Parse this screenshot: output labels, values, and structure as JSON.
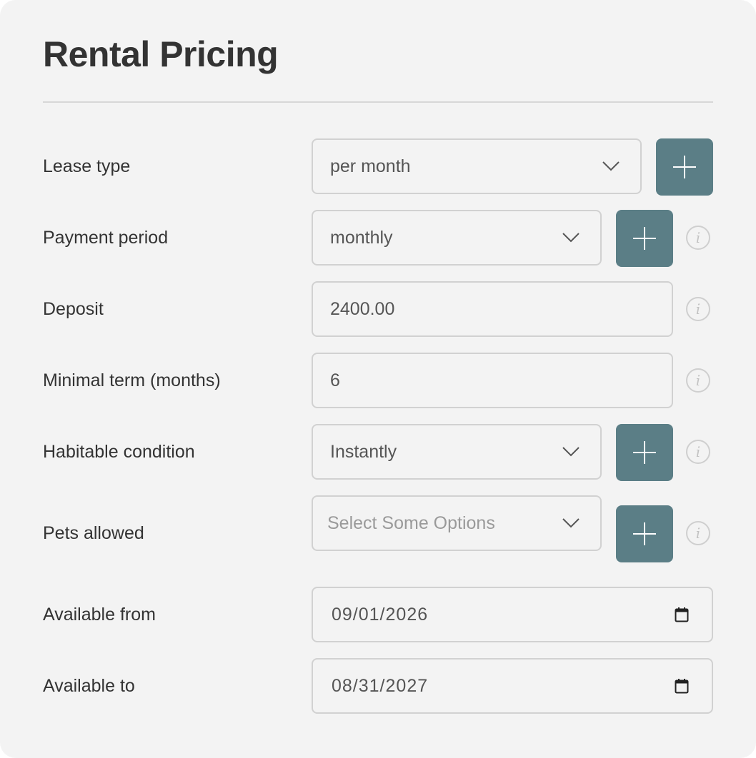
{
  "title": "Rental Pricing",
  "fields": {
    "lease_type": {
      "label": "Lease type",
      "value": "per month"
    },
    "payment_period": {
      "label": "Payment period",
      "value": "monthly"
    },
    "deposit": {
      "label": "Deposit",
      "value": "2400.00"
    },
    "minimal_term": {
      "label": "Minimal term (months)",
      "value": "6"
    },
    "habitable_condition": {
      "label": "Habitable condition",
      "value": "Instantly"
    },
    "pets_allowed": {
      "label": "Pets allowed",
      "placeholder": "Select Some Options"
    },
    "available_from": {
      "label": "Available from",
      "value": "09/01/2026"
    },
    "available_to": {
      "label": "Available to",
      "value": "08/31/2027"
    }
  },
  "icons": {
    "add": "plus-icon",
    "info": "info-icon",
    "dropdown": "chevron-down-icon",
    "date": "calendar-icon",
    "info_glyph": "i"
  },
  "colors": {
    "background": "#f3f3f3",
    "accent": "#5b7e86",
    "border": "#d1d1d1",
    "text": "#333333",
    "placeholder": "#9a9a9a"
  }
}
